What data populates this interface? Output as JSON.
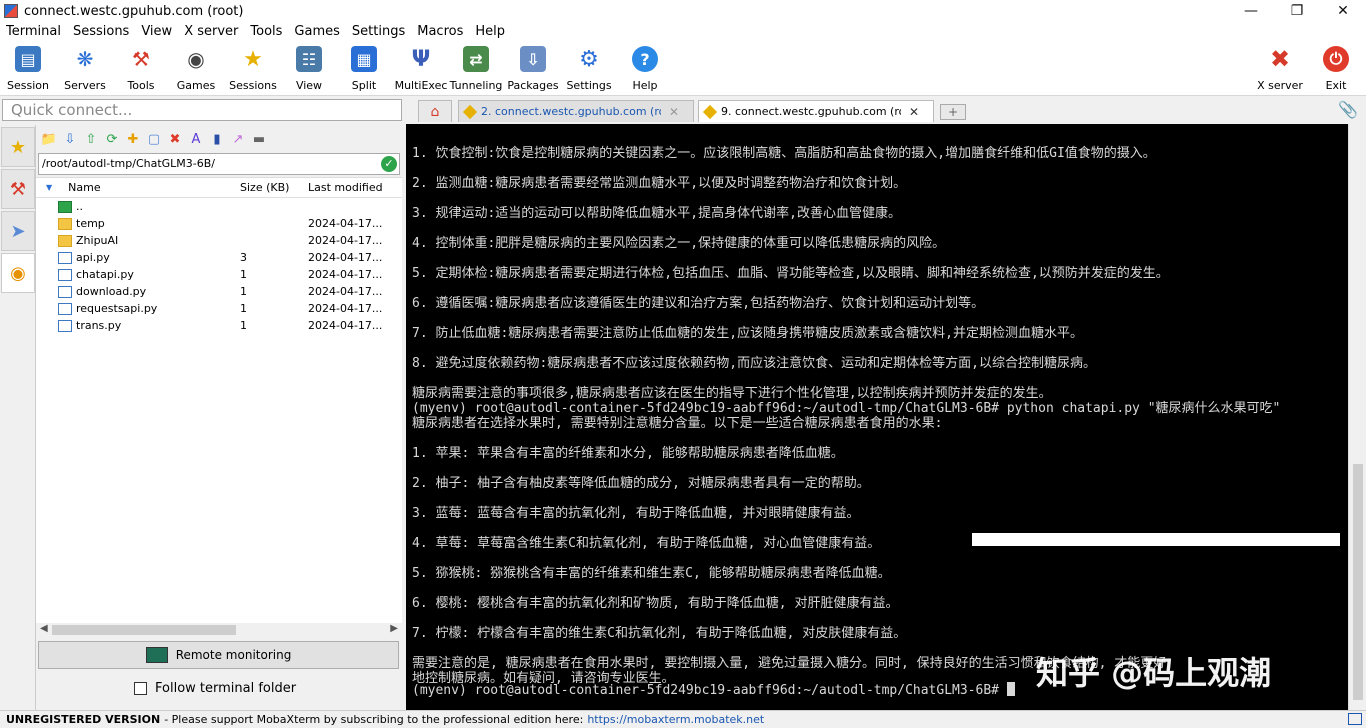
{
  "window": {
    "title": "connect.westc.gpuhub.com (root)"
  },
  "menu": [
    "Terminal",
    "Sessions",
    "View",
    "X server",
    "Tools",
    "Games",
    "Settings",
    "Macros",
    "Help"
  ],
  "toolbar": {
    "session": "Session",
    "servers": "Servers",
    "tools": "Tools",
    "games": "Games",
    "sessions": "Sessions",
    "view": "View",
    "split": "Split",
    "multiexec": "MultiExec",
    "tunneling": "Tunneling",
    "packages": "Packages",
    "settings": "Settings",
    "help": "Help",
    "xserver": "X server",
    "exit": "Exit"
  },
  "quick_connect": {
    "placeholder": "Quick connect..."
  },
  "tabs": [
    {
      "label": "2. connect.westc.gpuhub.com (root)",
      "active": false
    },
    {
      "label": "9. connect.westc.gpuhub.com (root)",
      "active": true
    }
  ],
  "sftp": {
    "path": "/root/autodl-tmp/ChatGLM3-6B/",
    "columns": {
      "name": "Name",
      "size": "Size (KB)",
      "modified": "Last modified"
    },
    "files": [
      {
        "name": "..",
        "size": "",
        "modified": "",
        "kind": "up"
      },
      {
        "name": "temp",
        "size": "",
        "modified": "2024-04-17...",
        "kind": "folder"
      },
      {
        "name": "ZhipuAI",
        "size": "",
        "modified": "2024-04-17...",
        "kind": "folder"
      },
      {
        "name": "api.py",
        "size": "3",
        "modified": "2024-04-17...",
        "kind": "py"
      },
      {
        "name": "chatapi.py",
        "size": "1",
        "modified": "2024-04-17...",
        "kind": "py"
      },
      {
        "name": "download.py",
        "size": "1",
        "modified": "2024-04-17...",
        "kind": "py"
      },
      {
        "name": "requestsapi.py",
        "size": "1",
        "modified": "2024-04-17...",
        "kind": "py"
      },
      {
        "name": "trans.py",
        "size": "1",
        "modified": "2024-04-17...",
        "kind": "py"
      }
    ],
    "remote_monitoring": "Remote monitoring",
    "follow_terminal": "Follow terminal folder"
  },
  "terminal": {
    "lines": [
      "1. 饮食控制:饮食是控制糖尿病的关键因素之一。应该限制高糖、高脂肪和高盐食物的摄入,增加膳食纤维和低GI值食物的摄入。",
      "2. 监测血糖:糖尿病患者需要经常监测血糖水平,以便及时调整药物治疗和饮食计划。",
      "3. 规律运动:适当的运动可以帮助降低血糖水平,提高身体代谢率,改善心血管健康。",
      "4. 控制体重:肥胖是糖尿病的主要风险因素之一,保持健康的体重可以降低患糖尿病的风险。",
      "5. 定期体检:糖尿病患者需要定期进行体检,包括血压、血脂、肾功能等检查,以及眼睛、脚和神经系统检查,以预防并发症的发生。",
      "6. 遵循医嘱:糖尿病患者应该遵循医生的建议和治疗方案,包括药物治疗、饮食计划和运动计划等。",
      "7. 防止低血糖:糖尿病患者需要注意防止低血糖的发生,应该随身携带糖皮质激素或含糖饮料,并定期检测血糖水平。",
      "8. 避免过度依赖药物:糖尿病患者不应该过度依赖药物,而应该注意饮食、运动和定期体检等方面,以综合控制糖尿病。",
      "糖尿病需要注意的事项很多,糖尿病患者应该在医生的指导下进行个性化管理,以控制疾病并预防并发症的发生。",
      "(myenv) root@autodl-container-5fd249bc19-aabff96d:~/autodl-tmp/ChatGLM3-6B# python chatapi.py \"糖尿病什么水果可吃\"",
      "糖尿病患者在选择水果时, 需要特别注意糖分含量。以下是一些适合糖尿病患者食用的水果:",
      "1. 苹果: 苹果含有丰富的纤维素和水分, 能够帮助糖尿病患者降低血糖。",
      "2. 柚子: 柚子含有柚皮素等降低血糖的成分, 对糖尿病患者具有一定的帮助。",
      "3. 蓝莓: 蓝莓含有丰富的抗氧化剂, 有助于降低血糖, 并对眼睛健康有益。",
      "4. 草莓: 草莓富含维生素C和抗氧化剂, 有助于降低血糖, 对心血管健康有益。",
      "5. 猕猴桃: 猕猴桃含有丰富的纤维素和维生素C, 能够帮助糖尿病患者降低血糖。",
      "6. 樱桃: 樱桃含有丰富的抗氧化剂和矿物质, 有助于降低血糖, 对肝脏健康有益。",
      "7. 柠檬: 柠檬含有丰富的维生素C和抗氧化剂, 有助于降低血糖, 对皮肤健康有益。",
      "需要注意的是, 糖尿病患者在食用水果时, 要控制摄入量, 避免过量摄入糖分。同时, 保持良好的生活习惯和饮食结构, 才能更好",
      "地控制糖尿病。如有疑问, 请咨询专业医生。",
      "(myenv) root@autodl-container-5fd249bc19-aabff96d:~/autodl-tmp/ChatGLM3-6B# "
    ],
    "watermark": "知乎 @码上观潮"
  },
  "status": {
    "unregistered": "UNREGISTERED VERSION",
    "message": "-  Please support MobaXterm by subscribing to the professional edition here:",
    "link": "https://mobaxterm.mobatek.net"
  }
}
